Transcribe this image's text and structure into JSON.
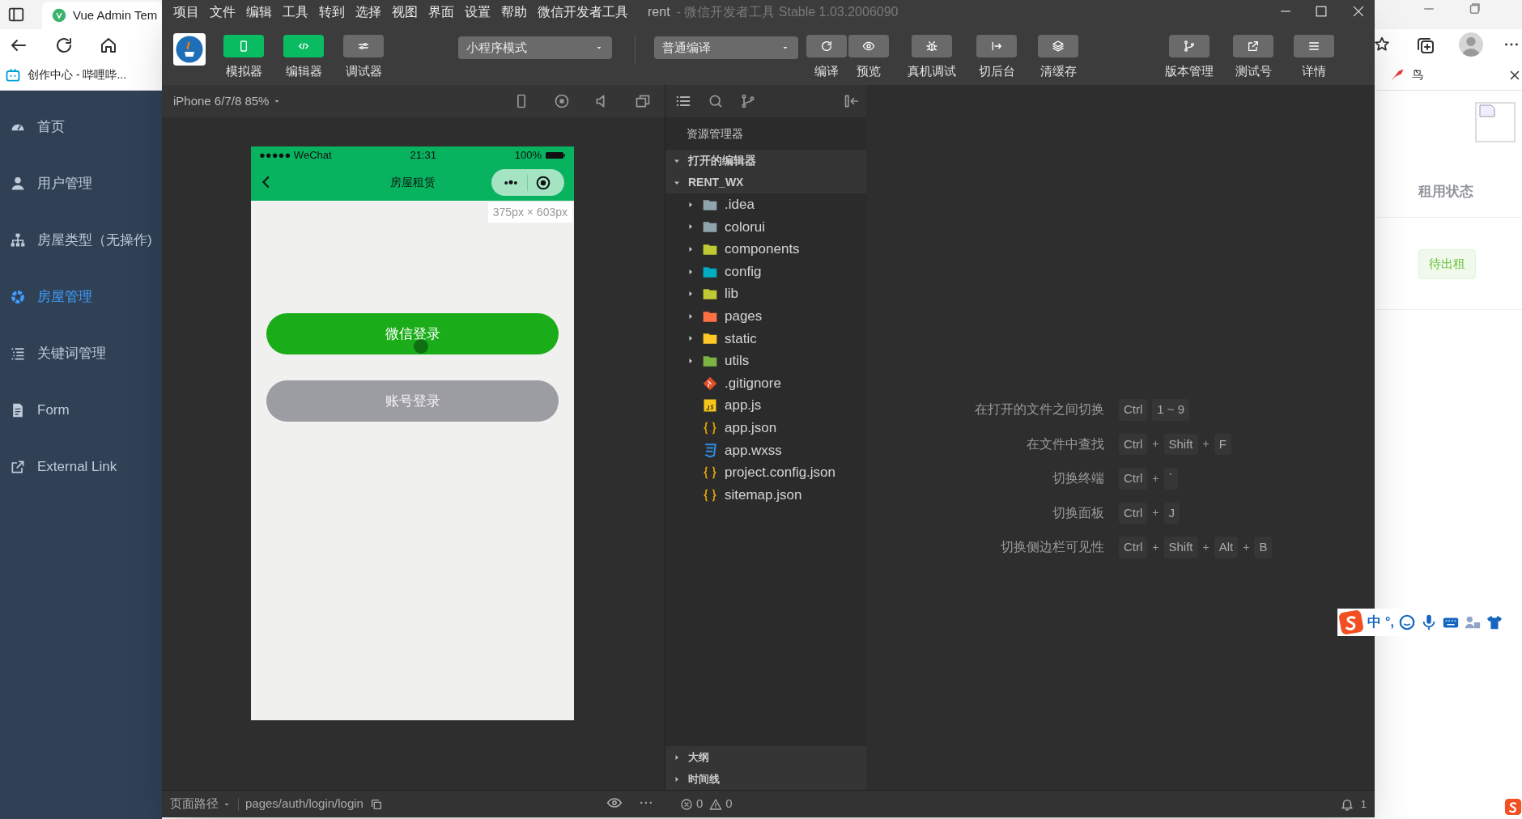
{
  "browser": {
    "tab_title": "Vue Admin Tem",
    "bookmarks": [
      {
        "label": "创作中心 - 哔哩哔..."
      },
      {
        "label": "鸟"
      }
    ],
    "sidebar": [
      {
        "label": "首页",
        "selected": false
      },
      {
        "label": "用户管理",
        "selected": false
      },
      {
        "label": "房屋类型（无操作)",
        "selected": false
      },
      {
        "label": "房屋管理",
        "selected": true
      },
      {
        "label": "关键词管理",
        "selected": false
      },
      {
        "label": "Form",
        "selected": false
      },
      {
        "label": "External Link",
        "selected": false
      }
    ],
    "table": {
      "column_header": "租用状态",
      "status_badge": "待出租"
    }
  },
  "devtools": {
    "menu": [
      "项目",
      "文件",
      "编辑",
      "工具",
      "转到",
      "选择",
      "视图",
      "界面",
      "设置",
      "帮助",
      "微信开发者工具"
    ],
    "title_project": "rent",
    "title_rest": "- 微信开发者工具 Stable 1.03.2006090",
    "view_toggles": [
      {
        "label": "模拟器",
        "selected": true
      },
      {
        "label": "编辑器",
        "selected": true
      },
      {
        "label": "调试器",
        "selected": false
      }
    ],
    "mode_select": "小程序模式",
    "compile_select": "普通编译",
    "actions": [
      "编译",
      "预览",
      "真机调试",
      "切后台",
      "清缓存"
    ],
    "right_actions": [
      "版本管理",
      "测试号",
      "详情"
    ],
    "simulator": {
      "device": "iPhone 6/7/8 85%",
      "carrier": "●●●●● WeChat",
      "time": "21:31",
      "battery": "100%",
      "nav_title": "房屋租赁",
      "size_hint": "375px × 603px",
      "buttons": [
        {
          "label": "微信登录",
          "kind": "primary"
        },
        {
          "label": "账号登录",
          "kind": "secondary"
        }
      ]
    },
    "explorer": {
      "title": "资源管理器",
      "sections": [
        {
          "label": "打开的编辑器",
          "expanded": true
        },
        {
          "label": "RENT_WX",
          "expanded": true,
          "children": [
            {
              "name": ".idea",
              "kind": "folder",
              "expanded": false,
              "color": "#90a4ae"
            },
            {
              "name": "colorui",
              "kind": "folder",
              "expanded": false,
              "color": "#90a4ae"
            },
            {
              "name": "components",
              "kind": "folder",
              "expanded": false,
              "color": "#c0ca33"
            },
            {
              "name": "config",
              "kind": "folder",
              "expanded": false,
              "color": "#00acc1"
            },
            {
              "name": "lib",
              "kind": "folder",
              "expanded": false,
              "color": "#c0ca33"
            },
            {
              "name": "pages",
              "kind": "folder",
              "expanded": false,
              "color": "#ff7043"
            },
            {
              "name": "static",
              "kind": "folder",
              "expanded": false,
              "color": "#ffca28"
            },
            {
              "name": "utils",
              "kind": "folder",
              "expanded": false,
              "color": "#7cb342"
            },
            {
              "name": ".gitignore",
              "kind": "git"
            },
            {
              "name": "app.js",
              "kind": "js"
            },
            {
              "name": "app.json",
              "kind": "json"
            },
            {
              "name": "app.wxss",
              "kind": "css"
            },
            {
              "name": "project.config.json",
              "kind": "json"
            },
            {
              "name": "sitemap.json",
              "kind": "json"
            }
          ]
        }
      ],
      "bottom_sections": [
        {
          "label": "大纲",
          "expanded": false
        },
        {
          "label": "时间线",
          "expanded": false
        }
      ]
    },
    "shortcuts": [
      {
        "label": "在打开的文件之间切换",
        "keys": [
          {
            "text": "Ctrl",
            "kind": "key"
          },
          {
            "text": "1 ~ 9",
            "kind": "key"
          }
        ]
      },
      {
        "label": "在文件中查找",
        "keys": [
          {
            "text": "Ctrl",
            "kind": "key"
          },
          {
            "text": "+",
            "kind": "sep"
          },
          {
            "text": "Shift",
            "kind": "key"
          },
          {
            "text": "+",
            "kind": "sep"
          },
          {
            "text": "F",
            "kind": "key"
          }
        ]
      },
      {
        "label": "切换终端",
        "keys": [
          {
            "text": "Ctrl",
            "kind": "key"
          },
          {
            "text": "+",
            "kind": "sep"
          },
          {
            "text": "`",
            "kind": "key"
          }
        ]
      },
      {
        "label": "切换面板",
        "keys": [
          {
            "text": "Ctrl",
            "kind": "key"
          },
          {
            "text": "+",
            "kind": "sep"
          },
          {
            "text": "J",
            "kind": "key"
          }
        ]
      },
      {
        "label": "切换侧边栏可见性",
        "keys": [
          {
            "text": "Ctrl",
            "kind": "key"
          },
          {
            "text": "+",
            "kind": "sep"
          },
          {
            "text": "Shift",
            "kind": "key"
          },
          {
            "text": "+",
            "kind": "sep"
          },
          {
            "text": "Alt",
            "kind": "key"
          },
          {
            "text": "+",
            "kind": "sep"
          },
          {
            "text": "B",
            "kind": "key"
          }
        ]
      }
    ],
    "status_bar": {
      "page_path_label": "页面路径",
      "page_path": "pages/auth/login/login",
      "errors": "0",
      "warnings": "0",
      "notifications": "1"
    }
  },
  "ime_toolbar": {
    "mode": "中",
    "punctuation": "°,"
  }
}
